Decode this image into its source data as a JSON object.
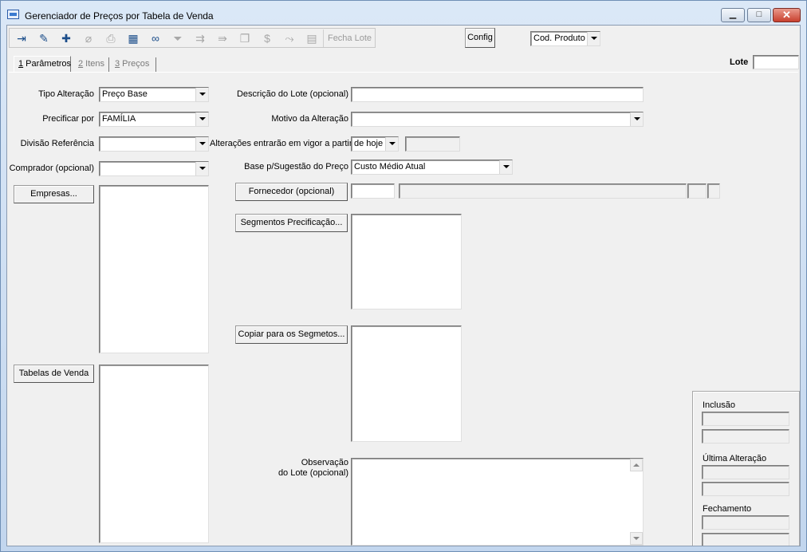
{
  "window": {
    "title": "Gerenciador de Preços por Tabela de Venda",
    "min_label": "▁",
    "max_label": "□",
    "close_label": "✕"
  },
  "toolbar": {
    "items": [
      {
        "name": "exit-icon",
        "glyph": "⇥",
        "enabled": true
      },
      {
        "name": "edit-icon",
        "glyph": "✎",
        "enabled": true
      },
      {
        "name": "add-icon",
        "glyph": "✚",
        "enabled": true
      },
      {
        "name": "attach-icon",
        "glyph": "⌀",
        "enabled": false
      },
      {
        "name": "print-icon",
        "glyph": "⎙",
        "enabled": false
      },
      {
        "name": "grid-icon",
        "glyph": "▦",
        "enabled": true
      },
      {
        "name": "binoculars-icon",
        "glyph": "∞",
        "enabled": true
      },
      {
        "name": "filter-icon",
        "glyph": "⏷",
        "enabled": false
      },
      {
        "name": "import-icon",
        "glyph": "⇉",
        "enabled": false
      },
      {
        "name": "export-icon",
        "glyph": "⇛",
        "enabled": false
      },
      {
        "name": "copy-icon",
        "glyph": "❐",
        "enabled": false
      },
      {
        "name": "price-icon",
        "glyph": "$",
        "enabled": false
      },
      {
        "name": "chart-icon",
        "glyph": "⤳",
        "enabled": false
      },
      {
        "name": "table-icon",
        "glyph": "▤",
        "enabled": false
      }
    ],
    "fecha_lote": "Fecha Lote",
    "config": "Config",
    "code_select": "Cod. Produto"
  },
  "tabs": [
    {
      "key": "1",
      "label": " Parâmetros"
    },
    {
      "key": "2",
      "label": " Itens"
    },
    {
      "key": "3",
      "label": " Preços"
    }
  ],
  "lote": {
    "label": "Lote",
    "value": ""
  },
  "form": {
    "tipo_alteracao": {
      "label": "Tipo Alteração",
      "value": "Preço Base"
    },
    "precificar_por": {
      "label": "Precificar por",
      "value": "FAMÍLIA"
    },
    "divisao_referencia": {
      "label": "Divisão Referência",
      "value": ""
    },
    "comprador": {
      "label": "Comprador (opcional)",
      "value": ""
    },
    "empresas_button": "Empresas...",
    "tabelas_button": "Tabelas de Venda",
    "descricao_lote": {
      "label": "Descrição do Lote (opcional)",
      "value": ""
    },
    "motivo": {
      "label": "Motivo da Alteração",
      "value": ""
    },
    "vigor": {
      "label": "Alterações entrarão em vigor a partir",
      "value": "de hoje",
      "date": ""
    },
    "base_sugestao": {
      "label": "Base p/Sugestão do Preço",
      "value": "Custo Médio Atual"
    },
    "fornecedor_button": "Fornecedor (opcional)",
    "fornecedor_code": "",
    "fornecedor_name": "",
    "segmentos_button": "Segmentos Precificação...",
    "copiar_button": "Copiar para os Segmetos...",
    "observacao_label_1": "Observação",
    "observacao_label_2": "do Lote (opcional)",
    "observacao_value": ""
  },
  "audit": {
    "inclusao": "Inclusão",
    "ultima_alteracao": "Última Alteração",
    "fechamento": "Fechamento"
  }
}
